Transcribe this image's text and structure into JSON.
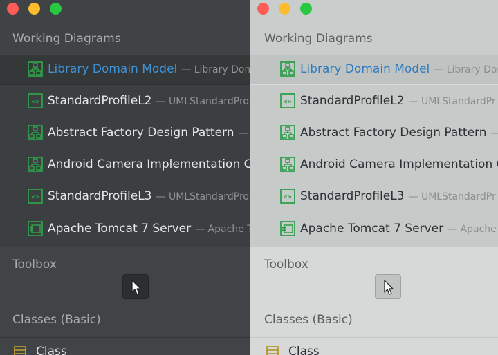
{
  "sections": {
    "working_diagrams": "Working Diagrams",
    "toolbox": "Toolbox",
    "classes_basic": "Classes (Basic)"
  },
  "colors": {
    "dark_bg": "#404345",
    "light_bg": "#c9cdcc",
    "selected_text": "#3f92d8",
    "icon_green": "#2ea84a"
  },
  "diagrams": [
    {
      "name": "Library Domain Model",
      "owner": "— Library Doma",
      "icon": "class-diagram-icon",
      "selected": true
    },
    {
      "name": "StandardProfileL2",
      "owner": "— UMLStandardPro",
      "icon": "profile-diagram-icon",
      "selected": false
    },
    {
      "name": "Abstract Factory Design Pattern",
      "owner": "— A",
      "icon": "class-diagram-icon",
      "selected": false
    },
    {
      "name": "Android Camera Implementation C",
      "owner": "",
      "icon": "class-diagram-icon",
      "selected": false
    },
    {
      "name": "StandardProfileL3",
      "owner": "— UMLStandardPro",
      "icon": "profile-diagram-icon",
      "selected": false
    },
    {
      "name": "Apache Tomcat 7 Server",
      "owner": "— Apache To",
      "icon": "component-diagram-icon",
      "selected": false
    }
  ],
  "diagrams_light": [
    {
      "name": "Library Domain Model",
      "owner": "— Library Don"
    },
    {
      "name": "StandardProfileL2",
      "owner": "— UMLStandardPr"
    },
    {
      "name": "Abstract Factory Design Pattern",
      "owner": "— A"
    },
    {
      "name": "Android Camera Implementation C",
      "owner": ""
    },
    {
      "name": "StandardProfileL3",
      "owner": "— UMLStandardPr"
    },
    {
      "name": "Apache Tomcat 7 Server",
      "owner": "— Apache T"
    }
  ],
  "toolbox": {
    "pointer_icon": "cursor-arrow-icon"
  },
  "classes": {
    "first_item": "Class"
  }
}
